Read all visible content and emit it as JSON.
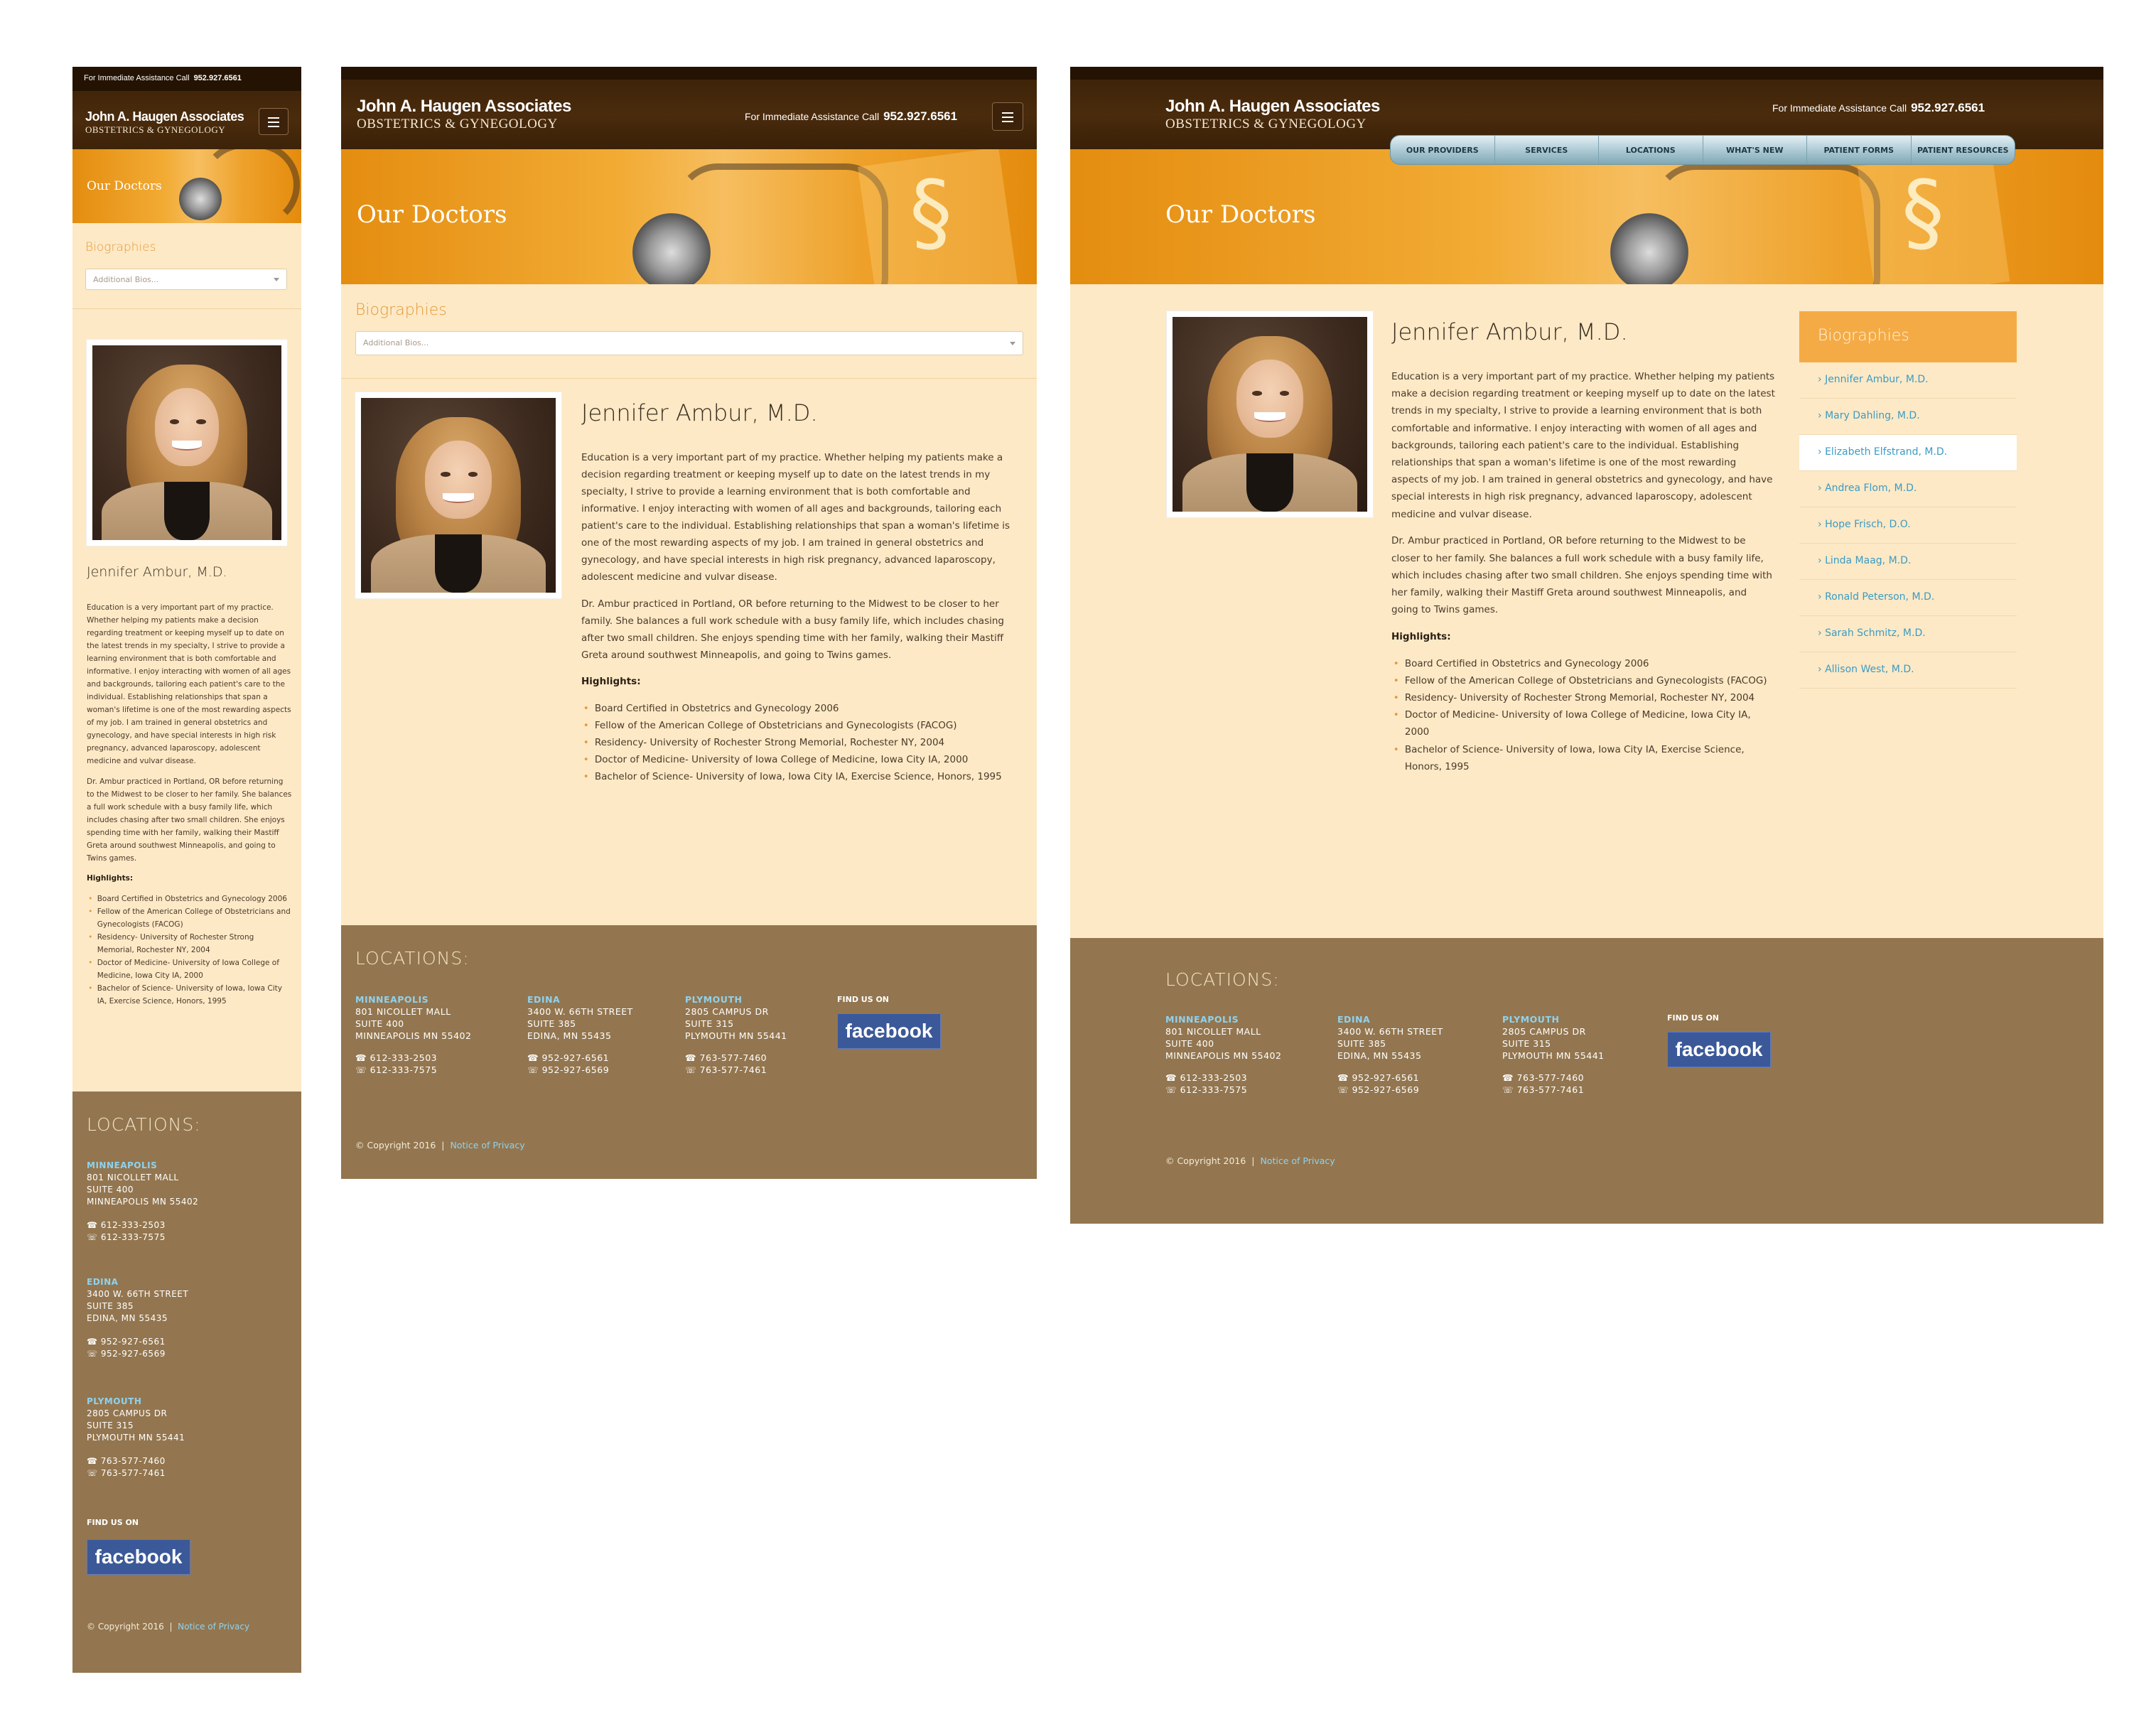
{
  "brand": {
    "name": "John A. Haugen Associates",
    "tagline": "OBSTETRICS & GYNEGOLOGY"
  },
  "assist": {
    "label": "For Immediate Assistance Call",
    "phone": "952.927.6561"
  },
  "nav": [
    "OUR PROVIDERS",
    "SERVICES",
    "LOCATIONS",
    "WHAT'S NEW",
    "PATIENT FORMS",
    "PATIENT RESOURCES"
  ],
  "page_title": "Our Doctors",
  "biographies": {
    "heading": "Biographies",
    "select_placeholder": "Additional Bios...",
    "items": [
      "Jennifer Ambur, M.D.",
      "Mary Dahling, M.D.",
      "Elizabeth Elfstrand, M.D.",
      "Andrea Flom, M.D.",
      "Hope Frisch, D.O.",
      "Linda Maag, M.D.",
      "Ronald Peterson, M.D.",
      "Sarah Schmitz, M.D.",
      "Allison West, M.D."
    ]
  },
  "doctor": {
    "name": "Jennifer Ambur, M.D.",
    "p1": "Education is a very important part of my practice. Whether helping my patients make a decision regarding treatment or keeping myself up to date on the latest trends in my specialty, I strive to provide a learning environment that is both comfortable and informative. I enjoy interacting with women of all ages and backgrounds, tailoring each patient's care to the individual. Establishing relationships that span a woman's lifetime is one of the most rewarding aspects of my job. I am trained in general obstetrics and gynecology, and have special interests in high risk pregnancy, advanced laparoscopy, adolescent medicine and vulvar disease.",
    "p2": "Dr. Ambur practiced in Portland, OR before returning to the Midwest to be closer to her family. She balances a full work schedule with a busy family life, which includes chasing after two small children. She enjoys spending time with her family, walking their Mastiff Greta around southwest Minneapolis, and going to Twins games.",
    "highlights_label": "Highlights:",
    "highlights": [
      "Board Certified in Obstetrics and Gynecology 2006",
      "Fellow of the American College of Obstetricians and Gynecologists (FACOG)",
      "Residency- University of Rochester Strong Memorial, Rochester NY, 2004",
      "Doctor of Medicine- University of Iowa College of Medicine, Iowa City IA, 2000",
      "Bachelor of Science- University of Iowa, Iowa City IA, Exercise Science, Honors, 1995"
    ]
  },
  "footer": {
    "locations_label": "LOCATIONS:",
    "locations": [
      {
        "city": "MINNEAPOLIS",
        "line1": "801 NICOLLET MALL",
        "line2": "SUITE 400",
        "line3": "MINNEAPOLIS MN 55402",
        "phone": "612-333-2503",
        "fax": "612-333-7575"
      },
      {
        "city": "EDINA",
        "line1": "3400 W. 66TH STREET",
        "line2": "SUITE 385",
        "line3": "EDINA, MN 55435",
        "phone": "952-927-6561",
        "fax": "952-927-6569"
      },
      {
        "city": "PLYMOUTH",
        "line1": "2805 CAMPUS DR",
        "line2": "SUITE 315",
        "line3": "PLYMOUTH MN 55441",
        "phone": "763-577-7460",
        "fax": "763-577-7461"
      }
    ],
    "find_us": "FIND US ON",
    "facebook": "facebook",
    "copyright": "© Copyright 2016",
    "privacy": "Notice of Privacy"
  },
  "icons": {
    "phone": "☎",
    "fax": "☎",
    "menu": "hamburger-icon",
    "caret": "caret-down-icon"
  },
  "colors": {
    "header": "#3a2108",
    "banner": "#f2ab34",
    "content_bg": "#fde9c6",
    "footer": "#93764f",
    "link": "#3b9bc4",
    "accent": "#e39a38",
    "facebook": "#3b5998"
  }
}
